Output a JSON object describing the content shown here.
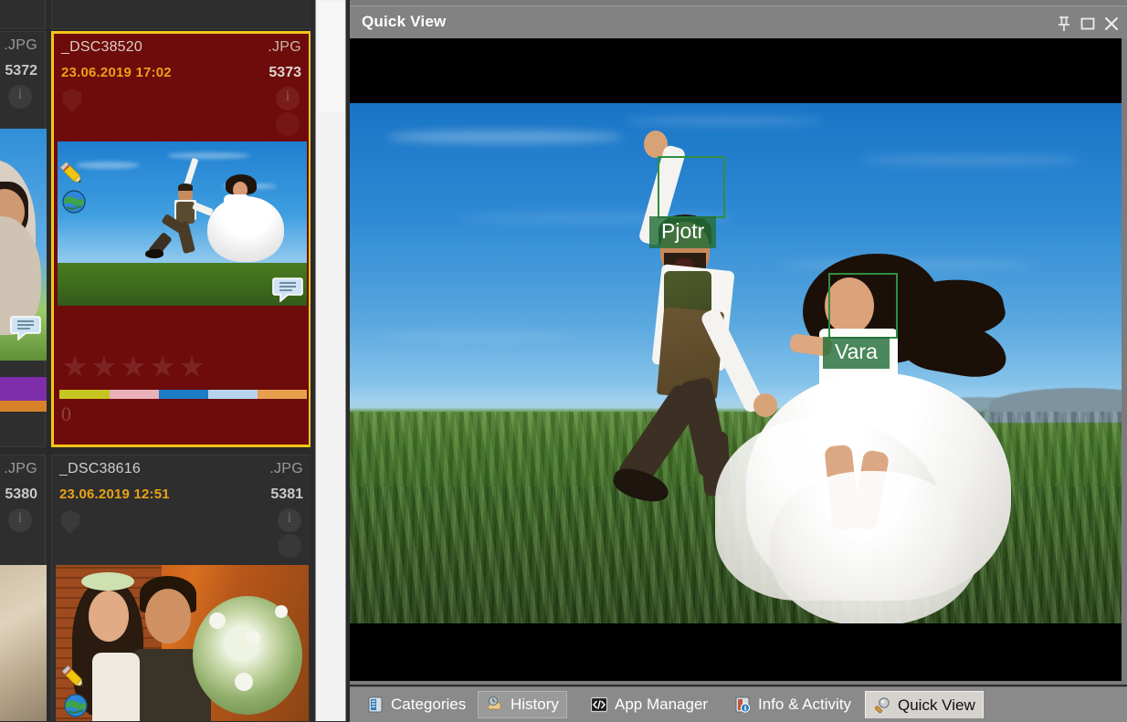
{
  "browser": {
    "tiles": [
      {
        "id": "left-partial-1",
        "ext": ".JPG",
        "number": "5372",
        "filename": "",
        "datetime": "",
        "selected": false
      },
      {
        "id": "selected-tile",
        "filename": "_DSC38520",
        "ext_left": "",
        "ext_right": ".JPG",
        "datetime": "23.06.2019 17:02",
        "number_right": "5373",
        "rating": "0",
        "rating_stars": 5,
        "rating_value": 0,
        "selected": true,
        "icons": [
          "pencil-icon",
          "globe-icon",
          "comment-icon",
          "shield-icon",
          "info-icon"
        ],
        "colorbar": [
          "#c7c520",
          "#eab0b8",
          "#1d7cc4",
          "#b7d3ee",
          "#e79f4e"
        ]
      },
      {
        "id": "left-partial-2",
        "ext": ".JPG",
        "number": "5380",
        "filename": "",
        "datetime": "",
        "selected": false
      },
      {
        "id": "tile-38616",
        "filename": "_DSC38616",
        "ext_right": ".JPG",
        "datetime": "23.06.2019 12:51",
        "number_right": "5381",
        "selected": false,
        "icons": [
          "pencil-icon",
          "globe-icon",
          "shield-icon",
          "info-icon"
        ]
      }
    ]
  },
  "quickview": {
    "title": "Quick View",
    "buttons": [
      {
        "name": "pin-icon",
        "label": "Pin"
      },
      {
        "name": "maximize-icon",
        "label": "Maximize"
      },
      {
        "name": "close-icon",
        "label": "Close"
      }
    ],
    "face_tags": [
      {
        "name": "Pjotr"
      },
      {
        "name": "Vara"
      }
    ],
    "face_box_color": "#2f8f3f",
    "tag_bg_color": "#236e37"
  },
  "tabbar": {
    "tabs": [
      {
        "label": "Categories",
        "icon": "categories-icon",
        "state": "normal"
      },
      {
        "label": "History",
        "icon": "history-icon",
        "state": "raised"
      },
      {
        "label": "App Manager",
        "icon": "app-manager-icon",
        "state": "normal"
      },
      {
        "label": "Info & Activity",
        "icon": "info-activity-icon",
        "state": "normal"
      },
      {
        "label": "Quick View",
        "icon": "quick-view-icon",
        "state": "active"
      }
    ]
  },
  "colors": {
    "selection_border": "#f5c518",
    "selected_bg": "#6e0b0b",
    "date_text": "#e8a317",
    "panel_bg": "#2a2a2a",
    "window_chrome": "#828282"
  }
}
